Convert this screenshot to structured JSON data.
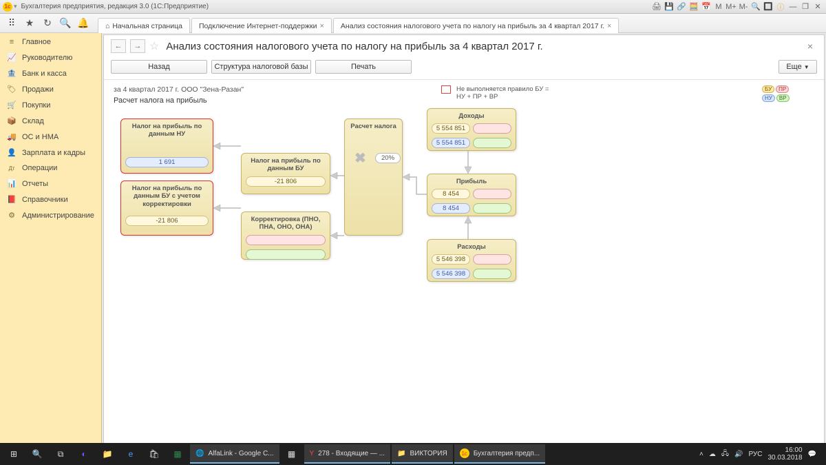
{
  "window": {
    "title": "Бухгалтерия предприятия, редакция 3.0  (1С:Предприятие)"
  },
  "tabs": {
    "home": "Начальная страница",
    "support": "Подключение Интернет-поддержки",
    "analysis": "Анализ состояния налогового учета по налогу на прибыль за 4 квартал 2017 г."
  },
  "sidebar": {
    "items": [
      {
        "label": "Главное",
        "icon": "≡"
      },
      {
        "label": "Руководителю",
        "icon": "📈"
      },
      {
        "label": "Банк и касса",
        "icon": "🏦"
      },
      {
        "label": "Продажи",
        "icon": "🏷"
      },
      {
        "label": "Покупки",
        "icon": "🛒"
      },
      {
        "label": "Склад",
        "icon": "📦"
      },
      {
        "label": "ОС и НМА",
        "icon": "🚚"
      },
      {
        "label": "Зарплата и кадры",
        "icon": "👤"
      },
      {
        "label": "Операции",
        "icon": "Дт"
      },
      {
        "label": "Отчеты",
        "icon": "📊"
      },
      {
        "label": "Справочники",
        "icon": "📕"
      },
      {
        "label": "Администрирование",
        "icon": "⚙"
      }
    ]
  },
  "page": {
    "title": "Анализ состояния налогового учета по налогу на прибыль за 4 квартал 2017 г.",
    "actions": {
      "back": "Назад",
      "structure": "Структура налоговой базы",
      "print": "Печать",
      "more": "Еще"
    },
    "period_line": "за 4 квартал 2017 г. ООО \"Зена-Разан\"",
    "subtitle": "Расчет налога на прибыль",
    "legend_rule": "Не выполняется правило БУ = НУ + ПР + ВР",
    "legend_tags": {
      "bu": "БУ",
      "pr": "ПР",
      "nu": "НУ",
      "vr": "ВР"
    }
  },
  "blocks": {
    "nu": {
      "title": "Налог на прибыль по данным НУ",
      "val": "1 691"
    },
    "bu_corr": {
      "title": "Налог на прибыль по данным БУ с учетом корректировки",
      "val": "-21 806"
    },
    "bu": {
      "title": "Налог на прибыль по данным БУ",
      "val": "-21 806"
    },
    "corr": {
      "title": "Корректировка (ПНО, ПНА, ОНО, ОНА)"
    },
    "calc": {
      "title": "Расчет налога",
      "pct": "20%"
    },
    "income": {
      "title": "Доходы",
      "v1": "5 554 851",
      "v2": "5 554 851"
    },
    "profit": {
      "title": "Прибыль",
      "v1": "8 454",
      "v2": "8 454"
    },
    "expense": {
      "title": "Расходы",
      "v1": "5 546 398",
      "v2": "5 546 398"
    }
  },
  "taskbar": {
    "items": [
      {
        "label": "AlfaLink - Google C..."
      },
      {
        "label": "278 - Входящие — ..."
      },
      {
        "label": "ВИКТОРИЯ"
      },
      {
        "label": "Бухгалтерия предп..."
      }
    ],
    "lang": "РУС",
    "time": "16:00",
    "date": "30.03.2018"
  }
}
